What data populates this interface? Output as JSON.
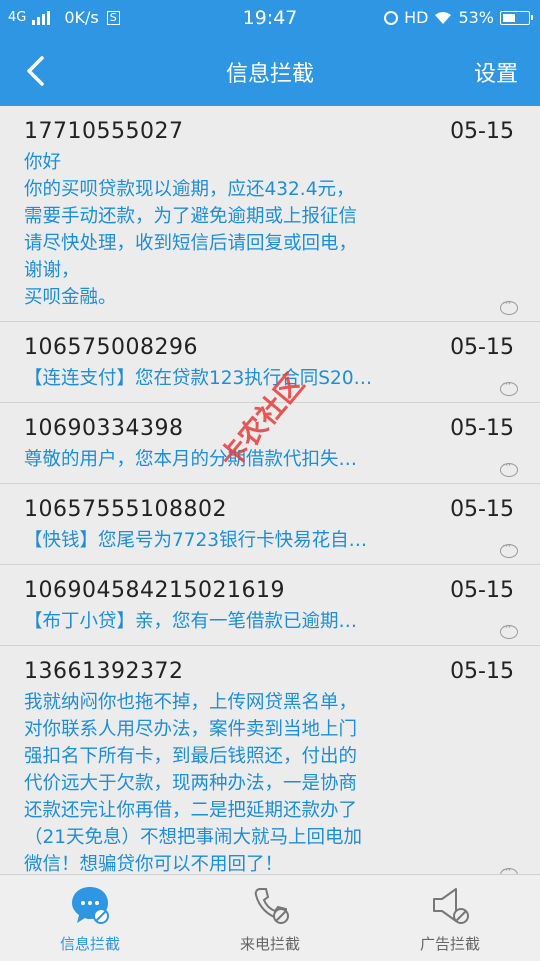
{
  "status_bar": {
    "network": "4G",
    "speed": "0K/s",
    "speed_badge": "S",
    "time": "19:47",
    "hd": "HD",
    "battery": "53%",
    "battery_level": 0.53
  },
  "header": {
    "title": "信息拦截",
    "settings_label": "设置"
  },
  "messages": [
    {
      "sender": "17710555027",
      "date": "05-15",
      "body": "你好\n你的买呗贷款现以逾期，应还432.4元，\n需要手动还款，为了避免逾期或上报征信\n请尽快处理，收到短信后请回复或回电，\n谢谢，\n买呗金融。"
    },
    {
      "sender": "106575008296",
      "date": "05-15",
      "body": "【连连支付】您在贷款123执行合同S20…"
    },
    {
      "sender": "10690334398",
      "date": "05-15",
      "body": "尊敬的用户，您本月的分期借款代扣失…"
    },
    {
      "sender": "10657555108802",
      "date": "05-15",
      "body": "【快钱】您尾号为7723银行卡快易花自…"
    },
    {
      "sender": "10690458421502161​9",
      "date": "05-15",
      "body": "【布丁小贷】亲，您有一笔借款已逾期…"
    },
    {
      "sender": "13661392372",
      "date": "05-15",
      "body": "我就纳闷你也拖不掉，上传网贷黑名单，\n对你联系人用尽办法，案件卖到当地上门\n强扣名下所有卡，到最后钱照还，付出的\n代价远大于欠款，现两种办法，一是协商\n还款还完让你再借，二是把延期还款办了\n（21天免息）不想把事闹大就马上回电加\n微信！想骗贷你可以不用回了！"
    }
  ],
  "watermark": "卡农社区",
  "bottom_nav": [
    {
      "label": "信息拦截",
      "icon": "message-block-icon",
      "active": true
    },
    {
      "label": "来电拦截",
      "icon": "phone-block-icon",
      "active": false
    },
    {
      "label": "广告拦截",
      "icon": "ad-block-icon",
      "active": false
    }
  ],
  "colors": {
    "accent": "#2f96e3",
    "message_text": "#1e8ed8",
    "background": "#ececec"
  }
}
